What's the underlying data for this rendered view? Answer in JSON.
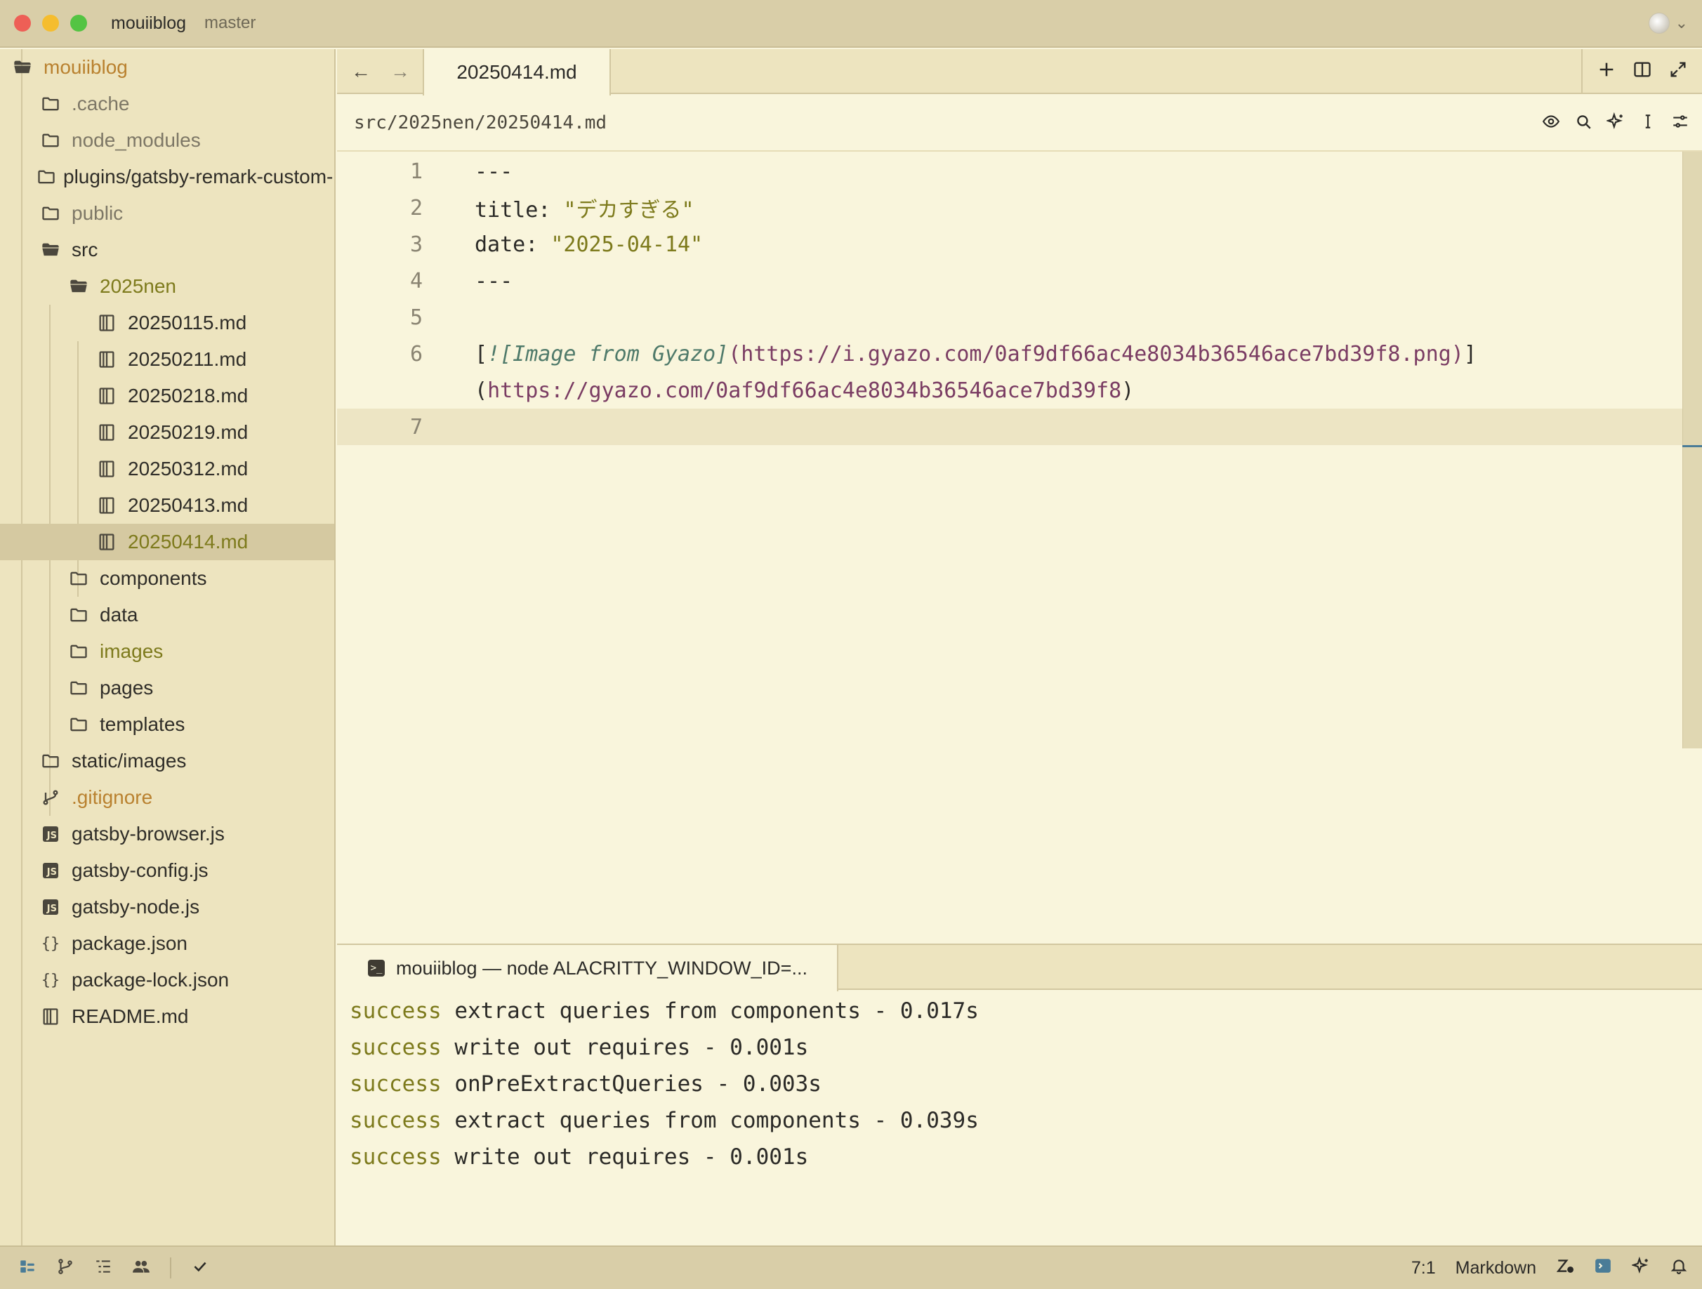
{
  "window": {
    "project": "mouiiblog",
    "branch": "master"
  },
  "sidebar": {
    "root": "mouiiblog",
    "items": [
      {
        "label": ".cache",
        "indent": 1,
        "icon": "folder-icon",
        "tone": "dim"
      },
      {
        "label": "node_modules",
        "indent": 1,
        "icon": "folder-icon",
        "tone": "dim"
      },
      {
        "label": "plugins/gatsby-remark-custom-image",
        "indent": 1,
        "icon": "folder-icon",
        "tone": "normal"
      },
      {
        "label": "public",
        "indent": 1,
        "icon": "folder-icon",
        "tone": "dim"
      },
      {
        "label": "src",
        "indent": 1,
        "icon": "folder-open-icon",
        "tone": "normal"
      },
      {
        "label": "2025nen",
        "indent": 2,
        "icon": "folder-open-icon",
        "tone": "olive"
      },
      {
        "label": "20250115.md",
        "indent": 3,
        "icon": "book-icon",
        "tone": "normal"
      },
      {
        "label": "20250211.md",
        "indent": 3,
        "icon": "book-icon",
        "tone": "normal"
      },
      {
        "label": "20250218.md",
        "indent": 3,
        "icon": "book-icon",
        "tone": "normal"
      },
      {
        "label": "20250219.md",
        "indent": 3,
        "icon": "book-icon",
        "tone": "normal"
      },
      {
        "label": "20250312.md",
        "indent": 3,
        "icon": "book-icon",
        "tone": "normal"
      },
      {
        "label": "20250413.md",
        "indent": 3,
        "icon": "book-icon",
        "tone": "normal"
      },
      {
        "label": "20250414.md",
        "indent": 3,
        "icon": "book-icon",
        "tone": "olive",
        "selected": true
      },
      {
        "label": "components",
        "indent": 2,
        "icon": "folder-icon",
        "tone": "normal"
      },
      {
        "label": "data",
        "indent": 2,
        "icon": "folder-icon",
        "tone": "normal"
      },
      {
        "label": "images",
        "indent": 2,
        "icon": "folder-icon",
        "tone": "olive"
      },
      {
        "label": "pages",
        "indent": 2,
        "icon": "folder-icon",
        "tone": "normal"
      },
      {
        "label": "templates",
        "indent": 2,
        "icon": "folder-icon",
        "tone": "normal"
      },
      {
        "label": "static/images",
        "indent": 1,
        "icon": "folder-icon",
        "tone": "normal"
      },
      {
        "label": ".gitignore",
        "indent": 1,
        "icon": "git-icon",
        "tone": "orange"
      },
      {
        "label": "gatsby-browser.js",
        "indent": 1,
        "icon": "js-icon",
        "tone": "normal"
      },
      {
        "label": "gatsby-config.js",
        "indent": 1,
        "icon": "js-icon",
        "tone": "normal"
      },
      {
        "label": "gatsby-node.js",
        "indent": 1,
        "icon": "js-icon",
        "tone": "normal"
      },
      {
        "label": "package.json",
        "indent": 1,
        "icon": "json-icon",
        "tone": "normal"
      },
      {
        "label": "package-lock.json",
        "indent": 1,
        "icon": "json-icon",
        "tone": "normal"
      },
      {
        "label": "README.md",
        "indent": 1,
        "icon": "book-icon",
        "tone": "normal"
      }
    ]
  },
  "editor": {
    "tab_label": "20250414.md",
    "breadcrumb": "src/2025nen/20250414.md",
    "lines": [
      {
        "num": "1",
        "segments": [
          {
            "t": "---",
            "c": "key"
          }
        ]
      },
      {
        "num": "2",
        "segments": [
          {
            "t": "title: ",
            "c": "key"
          },
          {
            "t": "\"デカすぎる\"",
            "c": "str"
          }
        ]
      },
      {
        "num": "3",
        "segments": [
          {
            "t": "date: ",
            "c": "key"
          },
          {
            "t": "\"2025-04-14\"",
            "c": "str"
          }
        ]
      },
      {
        "num": "4",
        "segments": [
          {
            "t": "---",
            "c": "key"
          }
        ]
      },
      {
        "num": "5",
        "segments": []
      },
      {
        "num": "6",
        "segments": [
          {
            "t": "[",
            "c": "key"
          },
          {
            "t": "![Image from Gyazo]",
            "c": "img"
          },
          {
            "t": "(https://i.gyazo.com/0af9df66ac4e8034b36546ace7bd39f8.png)",
            "c": "link"
          },
          {
            "t": "]",
            "c": "key"
          }
        ]
      },
      {
        "num": "",
        "segments": [
          {
            "t": "(",
            "c": "key"
          },
          {
            "t": "https://gyazo.com/0af9df66ac4e8034b36546ace7bd39f8",
            "c": "link"
          },
          {
            "t": ")",
            "c": "key"
          }
        ]
      },
      {
        "num": "7",
        "segments": [],
        "current": true
      }
    ]
  },
  "terminal": {
    "tab_label": "mouiiblog — node ALACRITTY_WINDOW_ID=...",
    "lines": [
      {
        "status": "success",
        "text": " extract queries from components - 0.017s"
      },
      {
        "status": "success",
        "text": " write out requires - 0.001s"
      },
      {
        "status": "success",
        "text": " onPreExtractQueries - 0.003s"
      },
      {
        "status": "success",
        "text": " extract queries from components - 0.039s"
      },
      {
        "status": "success",
        "text": " write out requires - 0.001s"
      }
    ]
  },
  "statusbar": {
    "cursor": "7:1",
    "language": "Markdown"
  },
  "colors": {
    "accent": "#4a7c97",
    "olive": "#7d7a1c",
    "link": "#7a3c63"
  }
}
